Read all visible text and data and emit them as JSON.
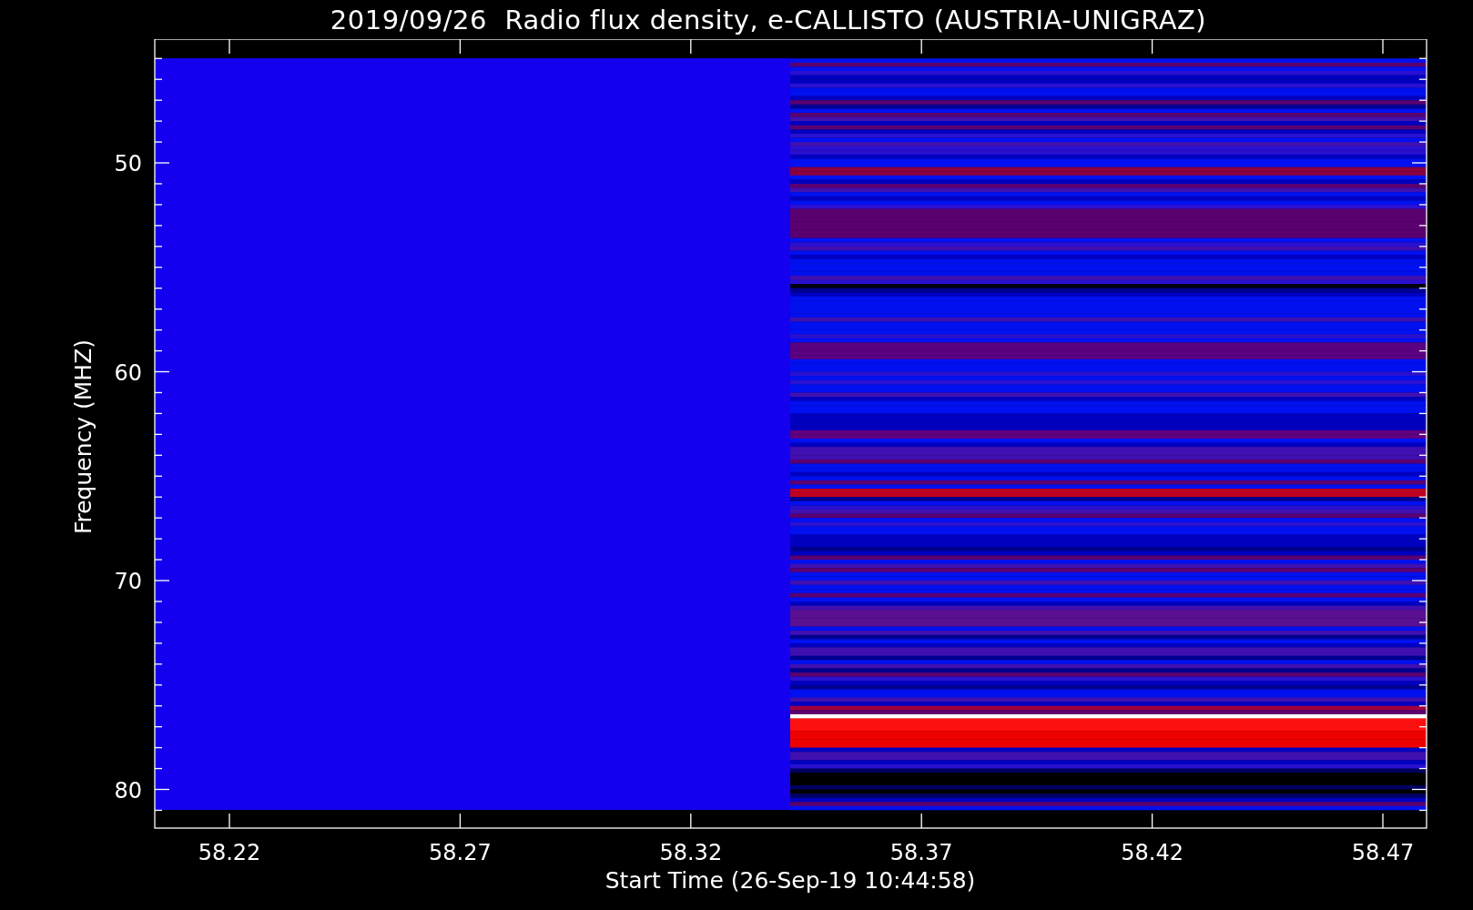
{
  "plot": {
    "title": "2019/09/26  Radio flux density, e-CALLISTO (AUSTRIA-UNIGRAZ)",
    "xlabel": "Start Time (26-Sep-19 10:44:58)",
    "ylabel": "Frequency (MHZ)",
    "xticks": [
      "58.22",
      "58.27",
      "58.32",
      "58.37",
      "58.42",
      "58.47"
    ],
    "yticks": [
      "50",
      "60",
      "70",
      "80"
    ]
  }
}
